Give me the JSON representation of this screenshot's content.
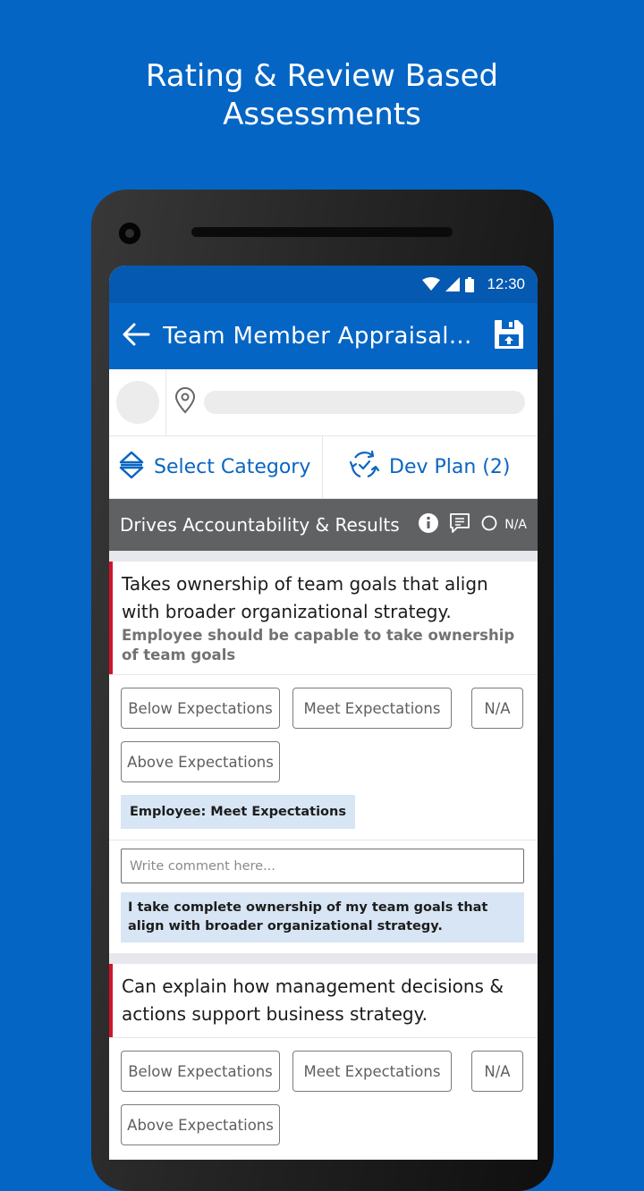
{
  "promo": {
    "headline_line1": "Rating & Review Based",
    "headline_line2": "Assessments"
  },
  "statusbar": {
    "time": "12:30",
    "icons": [
      "wifi-icon",
      "signal-icon",
      "battery-icon"
    ]
  },
  "appbar": {
    "title": "Team Member Appraisal...",
    "back_icon": "arrow-left-icon",
    "save_icon": "save-upload-icon"
  },
  "profile": {
    "avatar": "placeholder-avatar",
    "location_icon": "location-pin-icon"
  },
  "actions": {
    "select_category": "Select Category",
    "dev_plan": "Dev Plan (2)"
  },
  "category": {
    "name": "Drives Accountability & Results",
    "na_label": "N/A"
  },
  "questions": [
    {
      "text": "Takes ownership of team goals that align with broader organizational strategy.",
      "hint": "Employee should be capable to take ownership of team goals",
      "options": [
        "Below Expectations",
        "Meet Expectations",
        "N/A",
        "Above Expectations"
      ],
      "employee_rating": "Employee: Meet Expectations",
      "comment_placeholder": "Write comment here...",
      "employee_comment": "I take complete ownership of my team goals that align with broader organizational strategy."
    },
    {
      "text": "Can explain how management decisions & actions support business strategy.",
      "options": [
        "Below Expectations",
        "Meet Expectations",
        "N/A",
        "Above Expectations"
      ]
    }
  ]
}
